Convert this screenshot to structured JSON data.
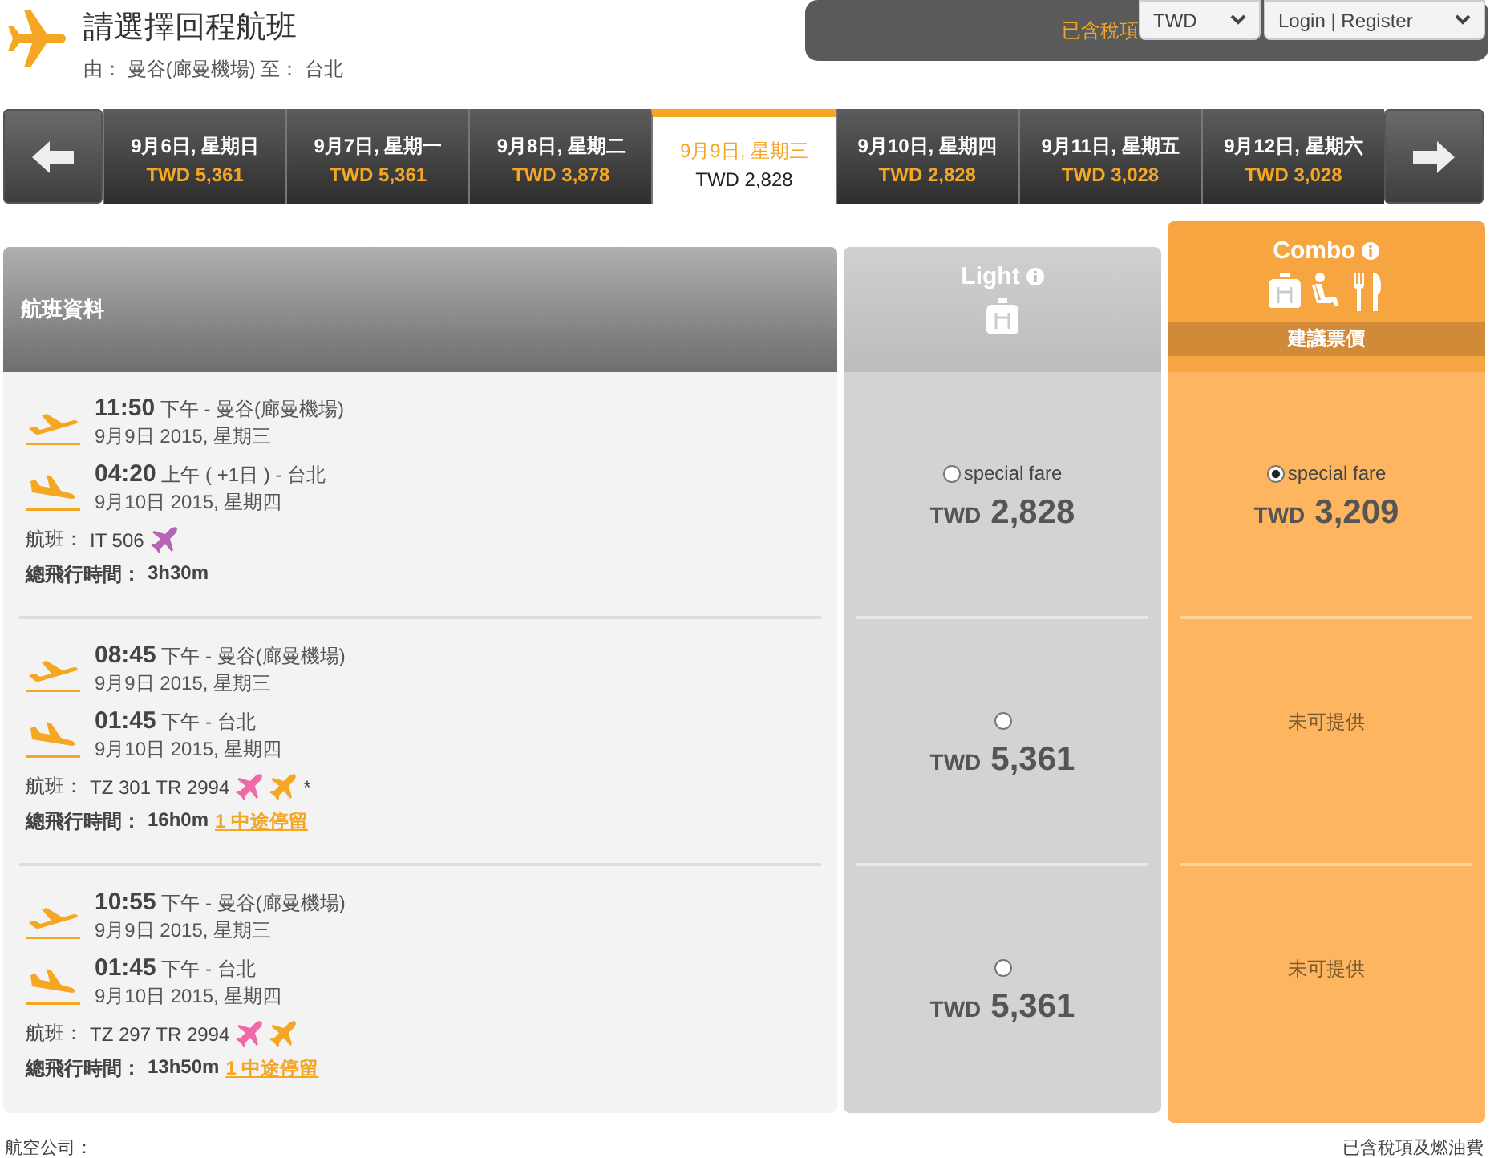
{
  "header": {
    "title": "請選擇回程航班",
    "route": "由： 曼谷(廊曼機場) 至： 台北"
  },
  "top_bar": {
    "notice": "已含稅項",
    "currency": "TWD",
    "account": "Login | Register"
  },
  "date_tabs": [
    {
      "date": "9月6日, 星期日",
      "price": "TWD 5,361",
      "selected": false
    },
    {
      "date": "9月7日, 星期一",
      "price": "TWD 5,361",
      "selected": false
    },
    {
      "date": "9月8日, 星期二",
      "price": "TWD 3,878",
      "selected": false
    },
    {
      "date": "9月9日, 星期三",
      "price": "TWD 2,828",
      "selected": true
    },
    {
      "date": "9月10日, 星期四",
      "price": "TWD 2,828",
      "selected": false
    },
    {
      "date": "9月11日, 星期五",
      "price": "TWD 3,028",
      "selected": false
    },
    {
      "date": "9月12日, 星期六",
      "price": "TWD 3,028",
      "selected": false
    }
  ],
  "table": {
    "info_header": "航班資料",
    "fare_columns": [
      {
        "name": "Light",
        "kind": "plain",
        "icons": [
          {
            "kind": "bag"
          }
        ]
      },
      {
        "name": "Combo",
        "kind": "recommended",
        "icons": [
          {
            "kind": "bag"
          },
          {
            "kind": "seat"
          },
          {
            "kind": "meal"
          }
        ],
        "badge": "建議票價"
      }
    ],
    "flights": [
      {
        "depart": {
          "time": "11:50",
          "detail": "下午 - 曼谷(廊曼機場)",
          "date": "9月9日 2015, 星期三"
        },
        "arrive": {
          "time": "04:20",
          "detail": "上午 ( +1日 ) - 台北",
          "date": "9月10日 2015, 星期四"
        },
        "flight_label": "航班：",
        "flight_no": "IT 506",
        "airline_icons": [
          {
            "color": "#b565b5"
          }
        ],
        "duration_label": "總飛行時間：",
        "duration": "3h30m",
        "fares": [
          {
            "kind": "fare",
            "option": "special fare",
            "currency": "TWD",
            "amount": "2,828",
            "selected": false
          },
          {
            "kind": "fare",
            "option": "special fare",
            "currency": "TWD",
            "amount": "3,209",
            "selected": true
          }
        ]
      },
      {
        "depart": {
          "time": "08:45",
          "detail": "下午 - 曼谷(廊曼機場)",
          "date": "9月9日 2015, 星期三"
        },
        "arrive": {
          "time": "01:45",
          "detail": "下午 - 台北",
          "date": "9月10日 2015, 星期四"
        },
        "flight_label": "航班：",
        "flight_no": "TZ 301 TR 2994",
        "airline_icons": [
          {
            "color": "#f06aa8"
          },
          {
            "color": "#f5a623"
          }
        ],
        "note": "*",
        "duration_label": "總飛行時間：",
        "duration": "16h0m",
        "stops": "1 中途停留",
        "fares": [
          {
            "kind": "fare",
            "currency": "TWD",
            "amount": "5,361",
            "selected": false
          },
          {
            "kind": "unavailable",
            "text": "未可提供"
          }
        ]
      },
      {
        "depart": {
          "time": "10:55",
          "detail": "下午 - 曼谷(廊曼機場)",
          "date": "9月9日 2015, 星期三"
        },
        "arrive": {
          "time": "01:45",
          "detail": "下午 - 台北",
          "date": "9月10日 2015, 星期四"
        },
        "flight_label": "航班：",
        "flight_no": "TZ 297 TR 2994",
        "airline_icons": [
          {
            "color": "#f06aa8"
          },
          {
            "color": "#f5a623"
          }
        ],
        "duration_label": "總飛行時間：",
        "duration": "13h50m",
        "stops": "1 中途停留",
        "fares": [
          {
            "kind": "fare",
            "currency": "TWD",
            "amount": "5,361",
            "selected": false
          },
          {
            "kind": "unavailable",
            "text": "未可提供"
          }
        ]
      }
    ]
  },
  "footer": {
    "airline_label": "航空公司：",
    "note": "已含稅項及燃油費"
  }
}
